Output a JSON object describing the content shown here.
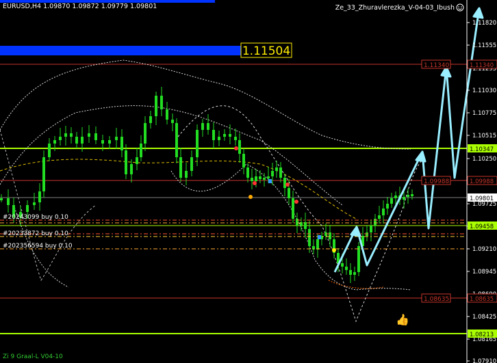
{
  "header": {
    "symbol_info": "EURUSD,H4  1.09870 1.09872 1.09779 1.09801",
    "indicator_name": "Ze_33_Zhuravlerezka_V-04-03_Ibush"
  },
  "footer": {
    "indicator_label": "Zi 9 Graal-L V04-10"
  },
  "price_box": {
    "value": "1.11504"
  },
  "axis": {
    "ticks": [
      "1.11820",
      "1.11555",
      "1.11295",
      "1.11030",
      "1.10775",
      "1.10515",
      "1.10250",
      "1.09990",
      "1.09725",
      "1.09460",
      "1.09210",
      "1.08945",
      "1.08690",
      "1.08425",
      "1.08165",
      "1.07910"
    ]
  },
  "levels": [
    {
      "label": "1.11340",
      "color": "#c8352b"
    },
    {
      "label": "1.10347",
      "color": "#aaff00"
    },
    {
      "label": "1.09988",
      "color": "#c8352b"
    },
    {
      "label": "1.09801",
      "color": "#ffffff"
    },
    {
      "label": "1.09458",
      "color": "#aaff00"
    },
    {
      "label": "1.08635",
      "color": "#c8352b"
    },
    {
      "label": "1.08213",
      "color": "#aaff00"
    }
  ],
  "orders": [
    {
      "label": "#20243099 buy 0.10"
    },
    {
      "label": "#20233872 buy 0.10"
    },
    {
      "label": "#202356594 buy 0.10"
    }
  ],
  "colors": {
    "candle": "#22dd22",
    "arrow": "#99eeff",
    "band": "#dddddd",
    "box": "#0033ff",
    "accent_yellow": "#ffee00"
  },
  "icons": [
    "smiley-icon",
    "thumbs-up-icon"
  ]
}
